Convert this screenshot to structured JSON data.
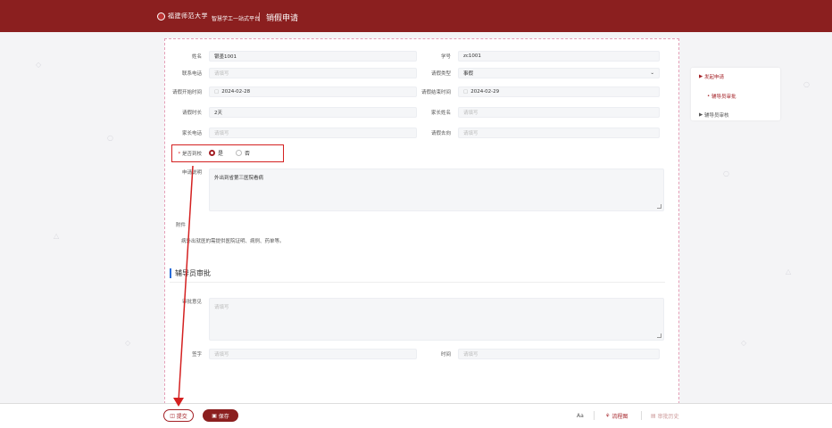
{
  "header": {
    "school": "福建师范大学",
    "platform": "智慧学工一站式平台",
    "title": "销假申请"
  },
  "form": {
    "name_label": "姓名",
    "name_value": "银墨1001",
    "id_label": "学号",
    "id_value": "zc1001",
    "phone_label": "联系电话",
    "phone_ph": "请填写",
    "type_label": "请假类型",
    "type_value": "事假",
    "start_label": "请假开始时间",
    "start_value": "2024-02-28",
    "end_label": "请假结束时间",
    "end_value": "2024-02-29",
    "duration_label": "请假时长",
    "duration_value": "2天",
    "parent_label": "家长姓名",
    "parent_ph": "请填写",
    "parentphone_label": "家长电话",
    "parentphone_ph": "请填写",
    "dest_label": "请假去向",
    "dest_ph": "请填写",
    "leave_label": "是否到校",
    "yes": "是",
    "no": "否",
    "reason_label": "申请说明",
    "reason_value": "外出到省第三医院看病",
    "attach_label": "附件",
    "attach_hint": "病外出就医的需提供医院证明、病例、药单等。"
  },
  "section": {
    "title": "辅导员审批",
    "opinion_label": "审批意见",
    "opinion_ph": "请填写",
    "sign_label": "签字",
    "sign_ph": "请填写",
    "time_label": "时间",
    "time_ph": "请填写"
  },
  "sidebar": {
    "item1": "发起申请",
    "item1_sub": "辅导员审批",
    "item2": "辅导员审核"
  },
  "bottom": {
    "submit": "提交",
    "save": "保存",
    "font": "Aa",
    "flow": "流程图",
    "history": "审批历史"
  }
}
